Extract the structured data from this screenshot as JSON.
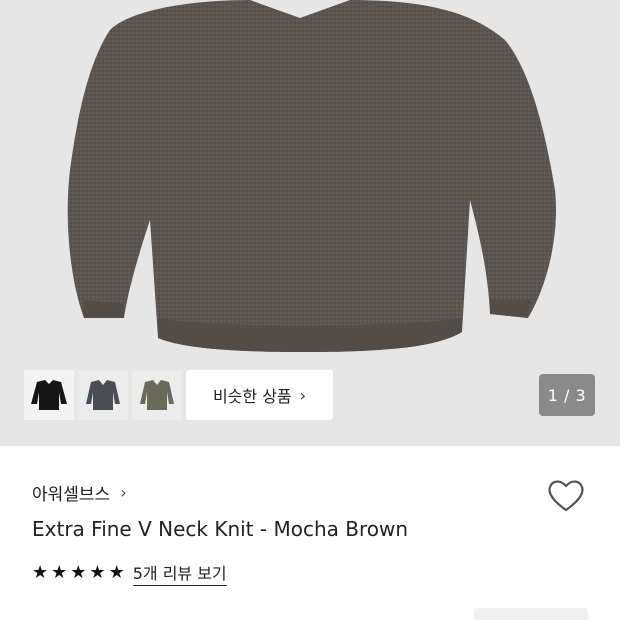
{
  "gallery": {
    "counter": "1 / 3",
    "similar_button_label": "비슷한 상품",
    "thumbnails": [
      {
        "icon": "black-sweater-thumbnail"
      },
      {
        "icon": "charcoal-sweater-thumbnail"
      },
      {
        "icon": "olive-sweater-thumbnail"
      }
    ]
  },
  "product": {
    "brand": "아워셀브스",
    "title": "Extra Fine V Neck Knit - Mocha Brown",
    "rating_stars": 5,
    "review_link": "5개 리뷰 보기"
  },
  "colors": {
    "hero_background": "#e6e6e6",
    "sweater": "#5b5652",
    "counter_background": "#8a8a8a"
  }
}
